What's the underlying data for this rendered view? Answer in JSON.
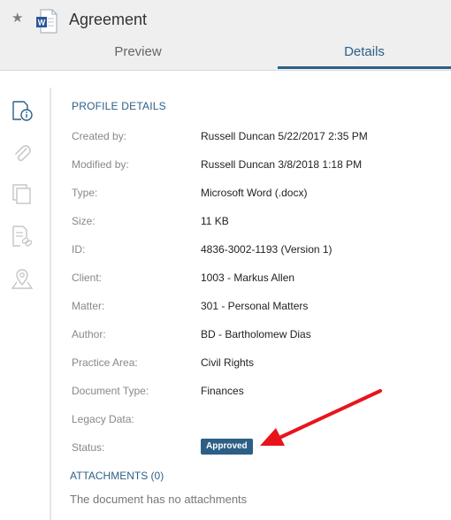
{
  "header": {
    "title": "Agreement",
    "tabs": [
      {
        "label": "Preview",
        "active": false
      },
      {
        "label": "Details",
        "active": true
      }
    ],
    "star_icon": "star-icon",
    "doc_icon": "word-document-icon"
  },
  "sidebar": {
    "icons": [
      "info-icon",
      "paperclip-icon",
      "copies-icon",
      "linked-document-icon",
      "location-pin-icon"
    ]
  },
  "profile": {
    "section_title": "PROFILE DETAILS",
    "fields": [
      {
        "label": "Created by:",
        "value": "Russell Duncan 5/22/2017 2:35 PM"
      },
      {
        "label": "Modified by:",
        "value": "Russell Duncan 3/8/2018 1:18 PM"
      },
      {
        "label": "Type:",
        "value": "Microsoft Word (.docx)"
      },
      {
        "label": "Size:",
        "value": "11 KB"
      },
      {
        "label": "ID:",
        "value": "4836-3002-1193 (Version 1)"
      },
      {
        "label": "Client:",
        "value": "1003 - Markus Allen"
      },
      {
        "label": "Matter:",
        "value": "301 - Personal Matters"
      },
      {
        "label": "Author:",
        "value": "BD - Bartholomew Dias"
      },
      {
        "label": "Practice Area:",
        "value": "Civil Rights"
      },
      {
        "label": "Document Type:",
        "value": "Finances"
      },
      {
        "label": "Legacy Data:",
        "value": ""
      },
      {
        "label": "Status:",
        "value": ""
      }
    ],
    "status_badge": "Approved"
  },
  "attachments": {
    "title": "ATTACHMENTS (0)",
    "empty_text": "The document has no attachments"
  },
  "colors": {
    "accent": "#2d5f86",
    "header_bg": "#efefef",
    "arrow": "#e8141c"
  }
}
